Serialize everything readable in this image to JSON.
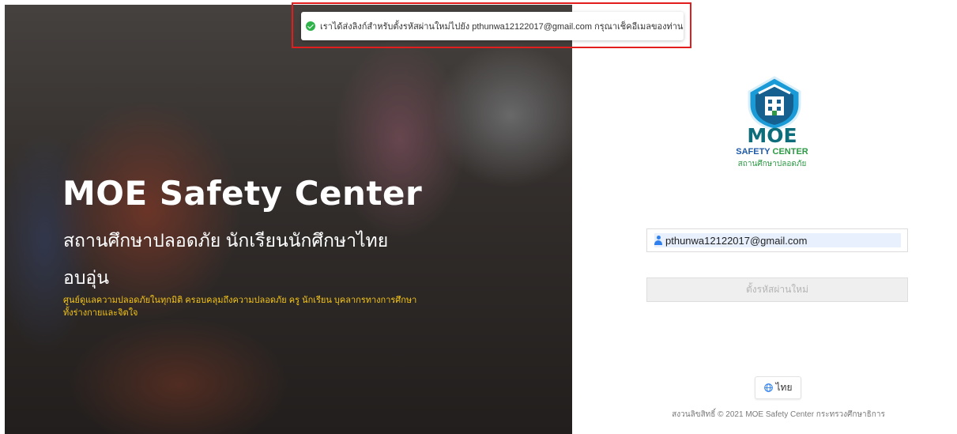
{
  "hero": {
    "title": "MOE Safety Center",
    "subtitle_line1": "สถานศึกษาปลอดภัย นักเรียนนักศึกษาไทย",
    "subtitle_line2": "อบอุ่น",
    "description_line1": "ศูนย์ดูแลความปลอดภัยในทุกมิติ ครอบคลุมถึงความปลอดภัย ครู นักเรียน บุคลากรทางการศึกษา",
    "description_line2": "ทั้งร่างกายและจิตใจ"
  },
  "toast": {
    "icon": "check-circle-icon",
    "message": "เราได้ส่งลิงก์สำหรับตั้งรหัสผ่านใหม่ไปยัง pthunwa12122017@gmail.com กรุณาเช็คอีเมลของท่าน"
  },
  "logo": {
    "icon": "school-shield-logo",
    "name": "MOE",
    "safety_word": "SAFETY",
    "center_word": "CENTER",
    "thai_tagline": "สถานศึกษาปลอดภัย"
  },
  "form": {
    "email_icon": "user-icon",
    "email_value": "pthunwa12122017@gmail.com",
    "submit_label": "ตั้งรหัสผ่านใหม่"
  },
  "language": {
    "icon": "globe-icon",
    "label": "ไทย"
  },
  "footer": {
    "copyright": "สงวนลิขสิทธิ์ © 2021 MOE Safety Center กระทรวงศึกษาธิการ"
  },
  "colors": {
    "accent_yellow": "#f5c518",
    "brand_teal": "#0d6d7a",
    "brand_blue": "#1f5ba8",
    "brand_green": "#2d9a45",
    "toast_border": "#e11d1d",
    "success": "#2eb24a"
  }
}
